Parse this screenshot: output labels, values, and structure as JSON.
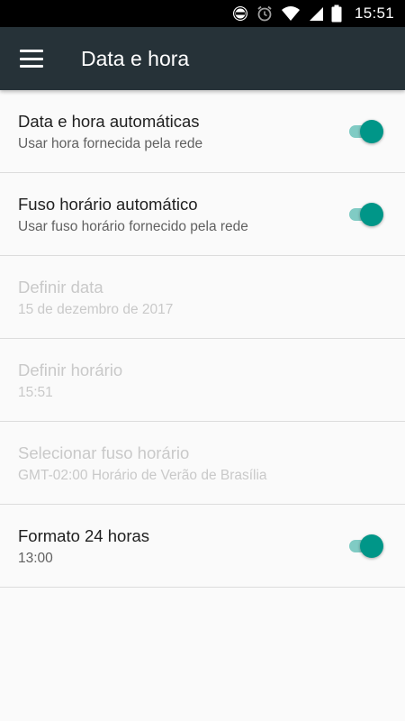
{
  "status_bar": {
    "time": "15:51",
    "icons": [
      "do-not-disturb-icon",
      "alarm-icon",
      "wifi-icon",
      "cellular-signal-icon",
      "battery-icon"
    ]
  },
  "app_bar": {
    "title": "Data e hora",
    "menu_icon": "menu-icon"
  },
  "colors": {
    "app_bar": "#263238",
    "accent": "#009688",
    "accent_track": "#80cbc4",
    "disabled_text": "#c9c9c9"
  },
  "settings": [
    {
      "title": "Data e hora automáticas",
      "summary": "Usar hora fornecida pela rede",
      "enabled": true,
      "switch_on": true
    },
    {
      "title": "Fuso horário automático",
      "summary": "Usar fuso horário fornecido pela rede",
      "enabled": true,
      "switch_on": true
    },
    {
      "title": "Definir data",
      "summary": "15 de dezembro de 2017",
      "enabled": false
    },
    {
      "title": "Definir horário",
      "summary": "15:51",
      "enabled": false
    },
    {
      "title": "Selecionar fuso horário",
      "summary": "GMT-02:00 Horário de Verão de Brasília",
      "enabled": false
    },
    {
      "title": "Formato 24 horas",
      "summary": "13:00",
      "enabled": true,
      "switch_on": true
    }
  ]
}
